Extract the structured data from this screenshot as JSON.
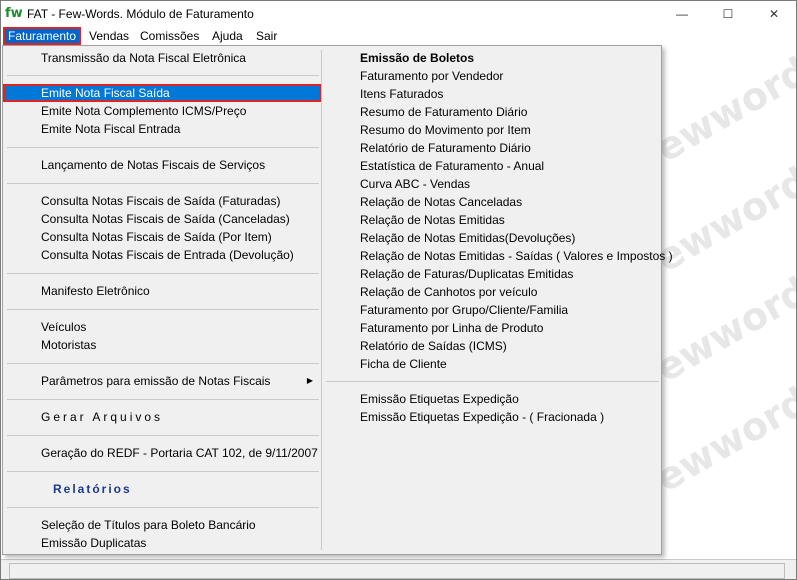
{
  "window": {
    "title": "FAT - Few-Words. Módulo de Faturamento",
    "icon_text": "fw",
    "minimize": "—",
    "maximize": "☐",
    "close": "✕"
  },
  "menubar": [
    "Faturamento",
    "Vendas",
    "Comissões",
    "Ajuda",
    "Sair"
  ],
  "watermark": "fewwords",
  "dropdown": {
    "col1": [
      "Transmissão da Nota Fiscal Eletrônica",
      "Emite Nota Fiscal Saída",
      "Emite Nota Complemento ICMS/Preço",
      "Emite Nota Fiscal Entrada",
      "Lançamento de Notas Fiscais de Serviços",
      "Consulta Notas Fiscais de Saída (Faturadas)",
      "Consulta Notas Fiscais de Saída (Canceladas)",
      "Consulta Notas Fiscais de Saída (Por Item)",
      "Consulta Notas Fiscais de Entrada (Devolução)",
      "Manifesto Eletrônico",
      "Veículos",
      "Motoristas",
      "Parâmetros para emissão de Notas Fiscais",
      "Gerar Arquivos",
      "Geração do REDF - Portaria CAT 102, de 9/11/2007",
      "Relatórios",
      "Seleção de Títulos para Boleto Bancário",
      "Emissão Duplicatas"
    ],
    "col2": [
      "Emissão de Boletos",
      "Faturamento por Vendedor",
      "Itens Faturados",
      "Resumo de Faturamento Diário",
      "Resumo do Movimento por Item",
      "Relatório de Faturamento Diário",
      "Estatística de Faturamento - Anual",
      "Curva ABC - Vendas",
      "Relação de Notas Canceladas",
      "Relação de Notas Emitidas",
      "Relação de Notas Emitidas(Devoluções)",
      "Relação de Notas Emitidas - Saídas ( Valores e Impostos )",
      "Relação de Faturas/Duplicatas Emitidas",
      "Relação de Canhotos por veículo",
      "Faturamento por Grupo/Cliente/Familia",
      "Faturamento por Linha de Produto",
      "Relatório de  Saídas (ICMS)",
      "Ficha de Cliente",
      "Emissão Etiquetas Expedição",
      "Emissão Etiquetas Expedição - ( Fracionada )"
    ],
    "submenu_arrow": "▶"
  }
}
